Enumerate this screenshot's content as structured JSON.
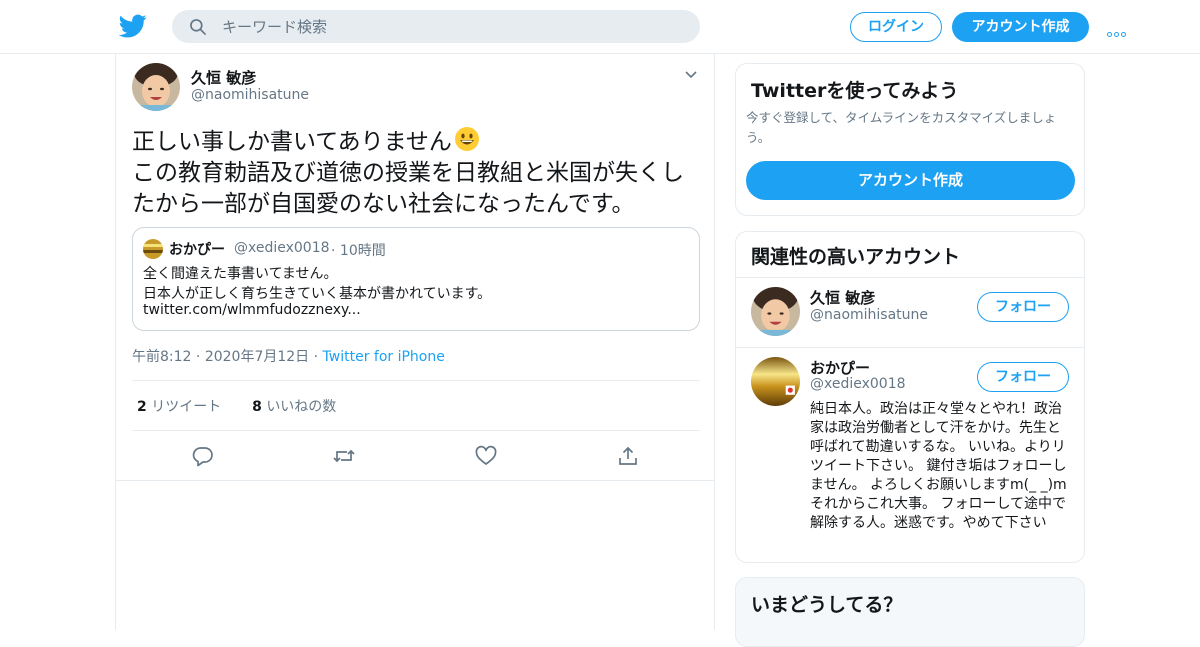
{
  "header": {
    "logo_icon": "twitter-bird-icon",
    "search_placeholder": "キーワード検索",
    "login_label": "ログイン",
    "signup_label": "アカウント作成",
    "more_icon": "more-dots-icon",
    "accent_color": "#1da1f2"
  },
  "tweet": {
    "author_name": "久恒 敏彦",
    "author_handle": "@naomihisatune",
    "text_line1": "正しい事しか書いてありません",
    "text_emoji": "grinning-face-emoji",
    "text_line2": "この教育勅語及び道徳の授業を日教組と米国が失くし",
    "text_line3": "たから一部が自国愛のない社会になったんです。",
    "quote": {
      "name": "おかぴー",
      "handle": "@xediex0018",
      "time": "10時間",
      "line1": "全く間違えた事書いてません。",
      "line2": "日本人が正しく育ち生きていく基本が書かれています。",
      "line3": "twitter.com/wlmmfudozznexy..."
    },
    "time": "午前8:12",
    "date": "2020年7月12日",
    "source": "Twitter for iPhone",
    "retweet_count": "2",
    "retweet_label": "リツイート",
    "like_count": "8",
    "like_label": "いいねの数",
    "actions": [
      "reply-icon",
      "retweet-icon",
      "like-icon",
      "share-icon"
    ]
  },
  "sidebar": {
    "signup_card": {
      "title": "Twitterを使ってみよう",
      "description": "今すぐ登録して、タイムラインをカスタマイズしましょう。",
      "button": "アカウント作成"
    },
    "related": {
      "title": "関連性の高いアカウント",
      "accounts": [
        {
          "name": "久恒 敏彦",
          "handle": "@naomihisatune",
          "follow": "フォロー"
        },
        {
          "name": "おかぴー",
          "handle": "@xediex0018",
          "follow": "フォロー",
          "bio": "純日本人。政治は正々堂々とやれ！政治家は政治労働者として汗をかけ。先生と呼ばれて勘違いするな。 いいね。よりリツイート下さい。 鍵付き垢はフォローしません。 よろしくお願いしますm(_ _)m それからこれ大事。 フォローして途中で解除する人。迷惑です。やめて下さい"
        }
      ]
    },
    "trends": {
      "title": "いまどうしてる？"
    }
  }
}
